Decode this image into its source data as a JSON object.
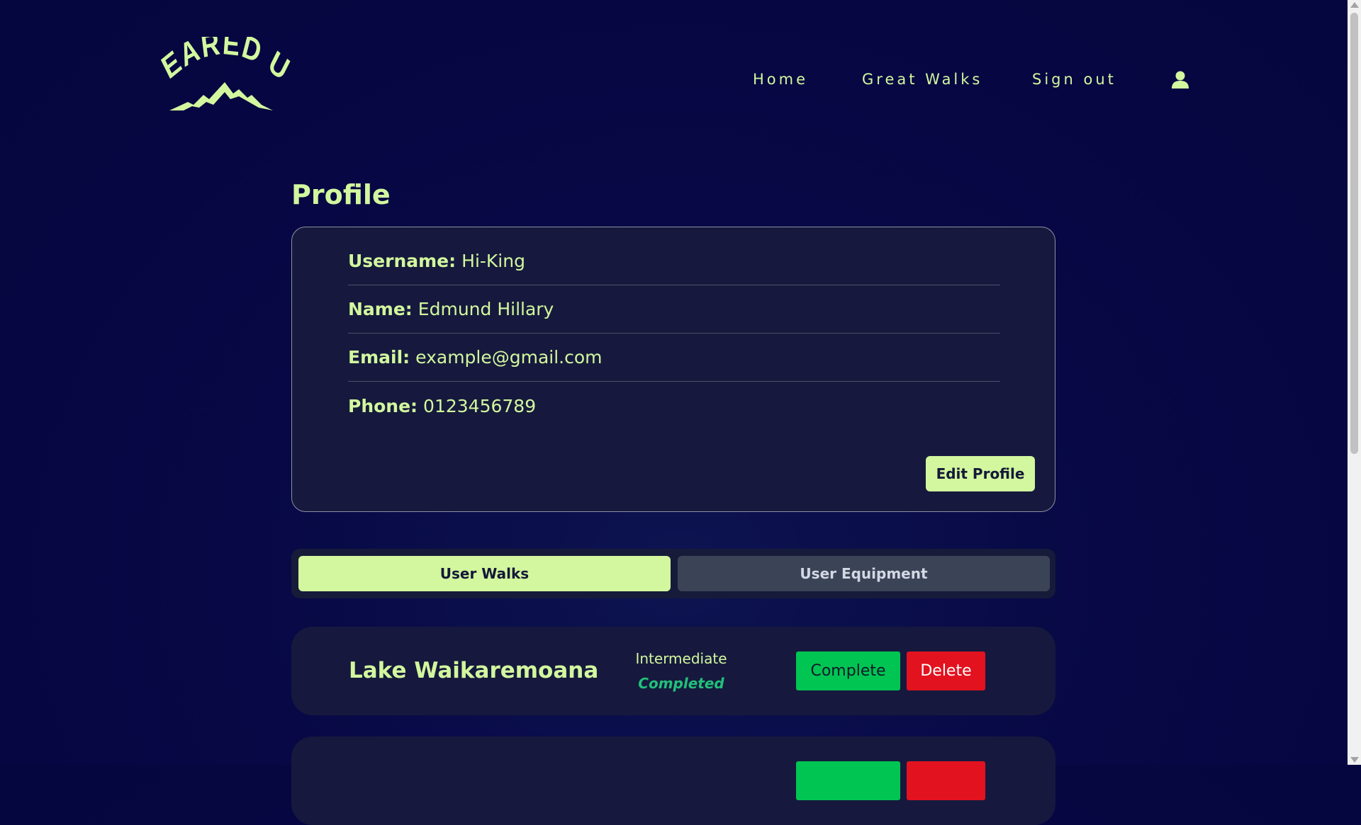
{
  "header": {
    "logo_text": "GEARED UP",
    "nav": {
      "home": "Home",
      "great_walks": "Great Walks",
      "sign_out": "Sign out"
    },
    "user_icon": "user-icon"
  },
  "page_title": "Profile",
  "profile": {
    "username_label": "Username:",
    "username": "Hi-King",
    "name_label": "Name:",
    "name": "Edmund Hillary",
    "email_label": "Email:",
    "email": "example@gmail.com",
    "phone_label": "Phone:",
    "phone": "0123456789",
    "edit_button": "Edit Profile"
  },
  "tabs": {
    "walks": "User Walks",
    "equipment": "User Equipment",
    "active": "User Walks"
  },
  "walks": [
    {
      "name": "Lake Waikaremoana",
      "difficulty": "Intermediate",
      "status": "Completed",
      "complete_label": "Complete",
      "delete_label": "Delete"
    },
    {
      "name": "",
      "difficulty": "",
      "status": "",
      "complete_label": "",
      "delete_label": ""
    }
  ],
  "colors": {
    "background": "#05053f",
    "accent": "#d2f79e",
    "card": "#16193d",
    "complete": "#00c553",
    "delete": "#e3121f",
    "status_completed": "#21c07a"
  }
}
